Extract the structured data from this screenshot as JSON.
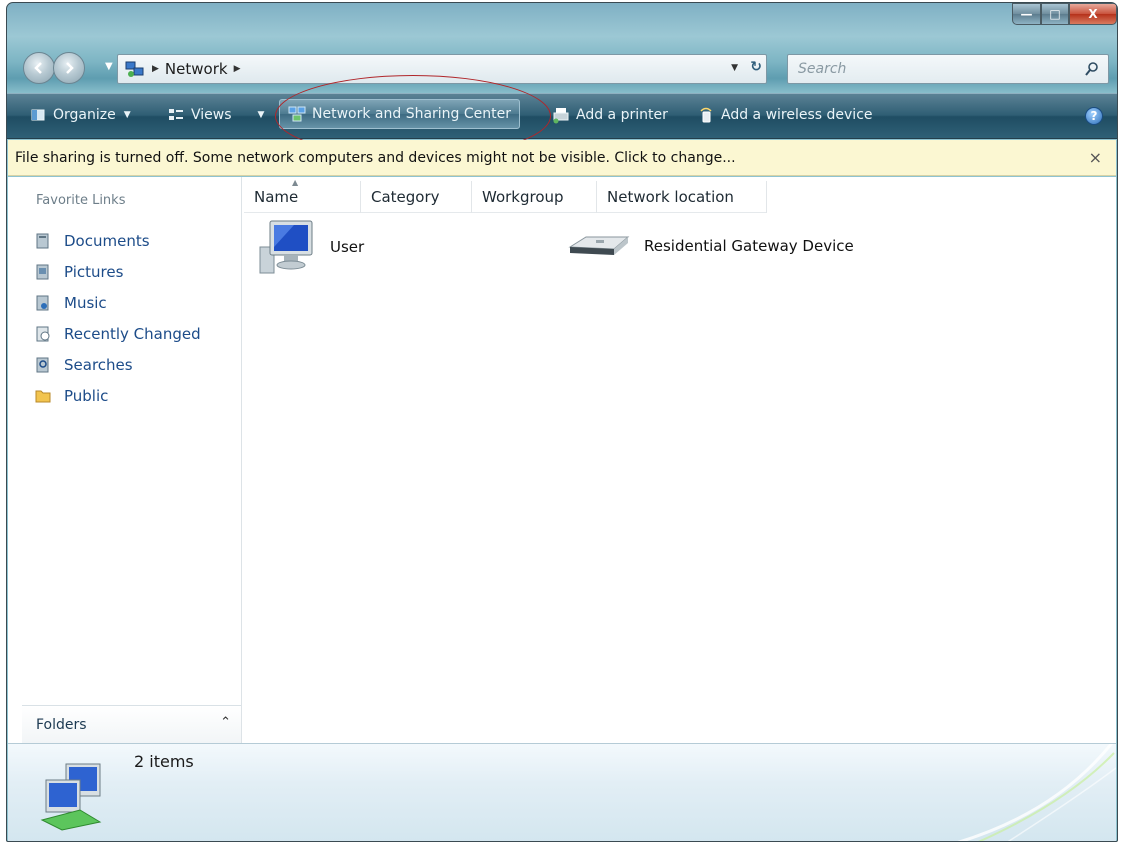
{
  "window": {
    "caption_buttons": {
      "minimize": "—",
      "maximize": "□",
      "close": "X"
    }
  },
  "nav": {
    "back_icon": "back-arrow-icon",
    "forward_icon": "forward-arrow-icon",
    "address": {
      "location": "Network"
    },
    "search": {
      "placeholder": "Search"
    }
  },
  "toolbar": {
    "organize": "Organize",
    "views": "Views",
    "network_sharing_center": "Network and Sharing Center",
    "add_printer": "Add a printer",
    "add_wireless": "Add a wireless device",
    "help": "?"
  },
  "infobar": {
    "message": "File sharing is turned off. Some network computers and devices might not be visible. Click to change...",
    "close": "×"
  },
  "sidebar": {
    "title": "Favorite Links",
    "items": [
      {
        "label": "Documents",
        "icon": "documents-icon"
      },
      {
        "label": "Pictures",
        "icon": "pictures-icon"
      },
      {
        "label": "Music",
        "icon": "music-icon"
      },
      {
        "label": "Recently Changed",
        "icon": "recently-changed-icon"
      },
      {
        "label": "Searches",
        "icon": "searches-icon"
      },
      {
        "label": "Public",
        "icon": "folder-icon"
      }
    ],
    "folders_label": "Folders",
    "folders_toggle": "⌃"
  },
  "columns": [
    "Name",
    "Category",
    "Workgroup",
    "Network location"
  ],
  "files": [
    {
      "label": "User",
      "icon": "computer-icon"
    },
    {
      "label": "Residential Gateway Device",
      "icon": "router-icon"
    }
  ],
  "details": {
    "count": "2 items"
  },
  "colors": {
    "command_bar": "#2f5e74",
    "infobar_bg": "#fbf7d2",
    "link_blue": "#1d4c89",
    "highlight_ring": "#b0262a"
  }
}
